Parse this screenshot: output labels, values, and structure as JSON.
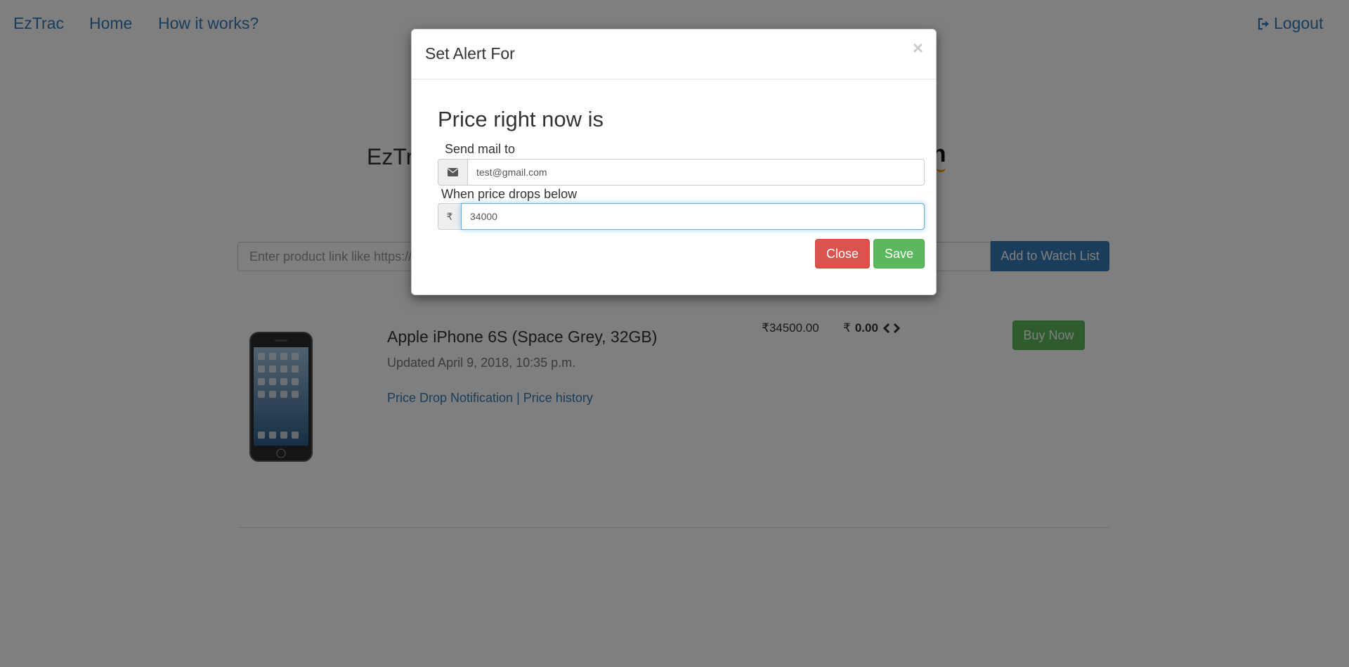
{
  "navbar": {
    "brand": "EzTrac",
    "home": "Home",
    "how_it_works": "How it works?",
    "logout": "Logout",
    "logout_icon": "sign-out-icon"
  },
  "hero": {
    "title_visible": "EzTr",
    "logo_visible": "zon"
  },
  "search": {
    "placeholder": "Enter product link like https://w",
    "button_label": "Add to Watch List"
  },
  "product": {
    "title": "Apple iPhone 6S (Space Grey, 32GB)",
    "updated": "Updated April 9, 2018, 10:35 p.m.",
    "link_notification": "Price Drop Notification",
    "link_separator": "|",
    "link_history": "Price history",
    "price": "₹34500.00",
    "price_drop_symbol": "₹",
    "price_drop_value": "0.00",
    "price_drop_icon": "code-icon",
    "buy_label": "Buy Now"
  },
  "modal": {
    "title": "Set Alert For",
    "close_symbol": "×",
    "heading": "Price right now is",
    "mail_label": "Send mail to",
    "mail_icon": "envelope-icon",
    "mail_value": "test@gmail.com",
    "price_label": "When price drops below",
    "price_icon": "₹",
    "price_value": "34000",
    "close_button": "Close",
    "save_button": "Save"
  },
  "colors": {
    "primary": "#337ab7",
    "success": "#5cb85c",
    "danger": "#d9534f",
    "backdrop": "rgba(0,0,0,0.5)"
  }
}
